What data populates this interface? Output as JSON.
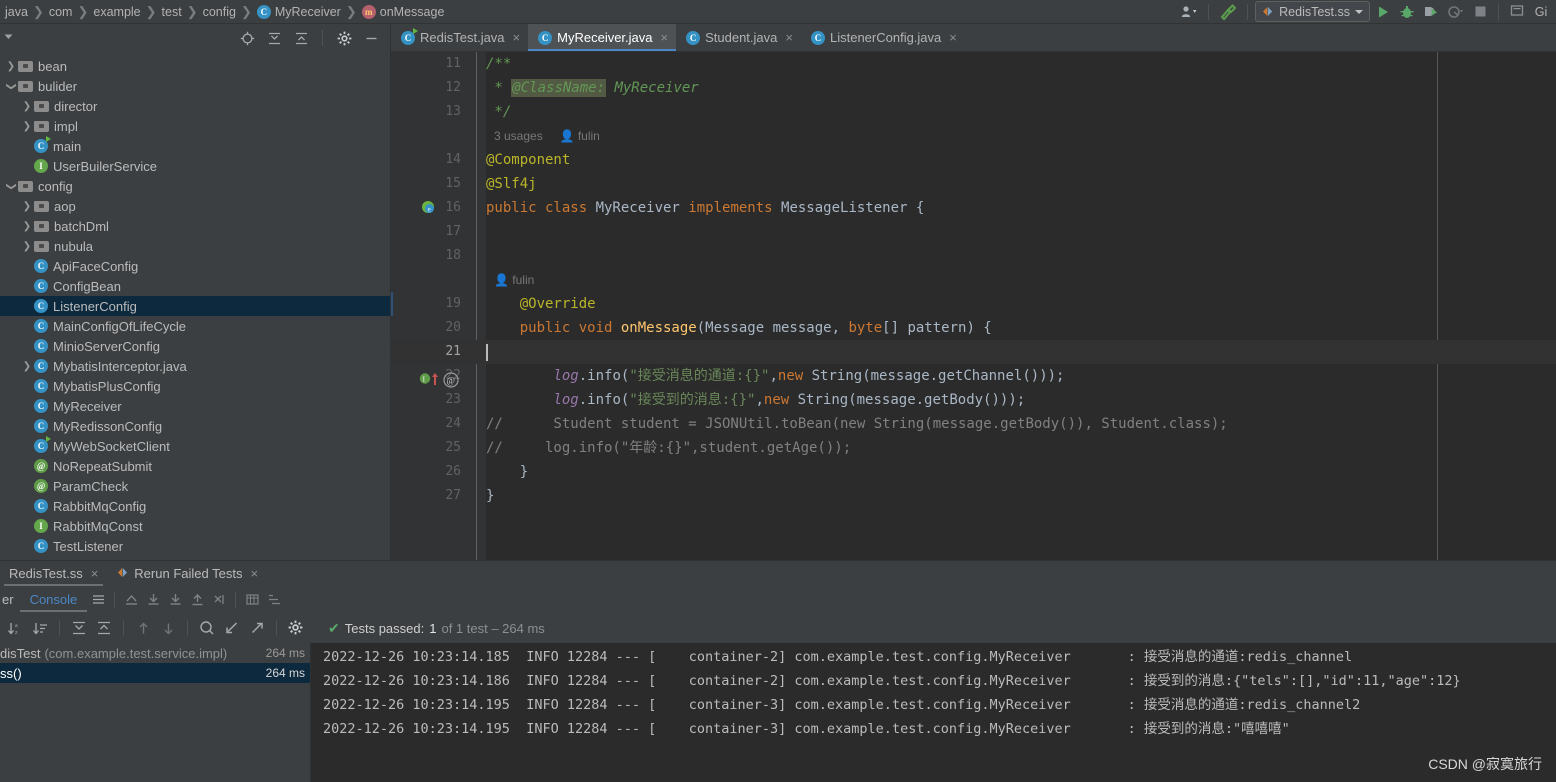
{
  "breadcrumb": {
    "items": [
      {
        "label": "java",
        "icon": null
      },
      {
        "label": "com",
        "icon": null
      },
      {
        "label": "example",
        "icon": null
      },
      {
        "label": "test",
        "icon": null
      },
      {
        "label": "config",
        "icon": null
      },
      {
        "label": "MyReceiver",
        "icon": "class-icon",
        "icon_letter": "C"
      },
      {
        "label": "onMessage",
        "icon": "method-icon",
        "icon_letter": "m"
      }
    ],
    "separator": "❯"
  },
  "toolbar": {
    "profiler_icon": "user-profiler-icon",
    "build_icon": "hammer-icon",
    "run_config": "RedisTest.ss",
    "run_icon": "run-icon",
    "debug_icon": "debug-icon",
    "run_coverage_icon": "run-with-coverage-icon",
    "profile_icon": "profile-icon",
    "stop_icon": "stop-icon",
    "search_icon": "search-everywhere-icon",
    "git_label": "Gi"
  },
  "project_panel": {
    "toolbar_icons": [
      "locate-icon",
      "expand-all-icon",
      "collapse-all-icon",
      "settings-icon",
      "hide-icon"
    ],
    "tree": [
      {
        "label": "bean",
        "kind": "folder",
        "indent": 0,
        "arrow": "collapsed"
      },
      {
        "label": "bulider",
        "kind": "folder",
        "indent": 0,
        "arrow": "expanded"
      },
      {
        "label": "director",
        "kind": "folder",
        "indent": 1,
        "arrow": "collapsed"
      },
      {
        "label": "impl",
        "kind": "folder",
        "indent": 1,
        "arrow": "collapsed"
      },
      {
        "label": "main",
        "kind": "class-runnable",
        "indent": 1,
        "arrow": "none"
      },
      {
        "label": "UserBuilerService",
        "kind": "interface",
        "indent": 1,
        "arrow": "none"
      },
      {
        "label": "config",
        "kind": "folder",
        "indent": 0,
        "arrow": "expanded"
      },
      {
        "label": "aop",
        "kind": "folder",
        "indent": 1,
        "arrow": "collapsed"
      },
      {
        "label": "batchDml",
        "kind": "folder",
        "indent": 1,
        "arrow": "collapsed"
      },
      {
        "label": "nubula",
        "kind": "folder",
        "indent": 1,
        "arrow": "collapsed"
      },
      {
        "label": "ApiFaceConfig",
        "kind": "class",
        "indent": 1,
        "arrow": "none"
      },
      {
        "label": "ConfigBean",
        "kind": "class",
        "indent": 1,
        "arrow": "none"
      },
      {
        "label": "ListenerConfig",
        "kind": "class",
        "indent": 1,
        "arrow": "none",
        "selected": true
      },
      {
        "label": "MainConfigOfLifeCycle",
        "kind": "class",
        "indent": 1,
        "arrow": "none"
      },
      {
        "label": "MinioServerConfig",
        "kind": "class",
        "indent": 1,
        "arrow": "none"
      },
      {
        "label": "MybatisInterceptor.java",
        "kind": "class",
        "indent": 1,
        "arrow": "collapsed"
      },
      {
        "label": "MybatisPlusConfig",
        "kind": "class",
        "indent": 1,
        "arrow": "none"
      },
      {
        "label": "MyReceiver",
        "kind": "class",
        "indent": 1,
        "arrow": "none"
      },
      {
        "label": "MyRedissonConfig",
        "kind": "class",
        "indent": 1,
        "arrow": "none"
      },
      {
        "label": "MyWebSocketClient",
        "kind": "class-runnable",
        "indent": 1,
        "arrow": "none"
      },
      {
        "label": "NoRepeatSubmit",
        "kind": "annotation",
        "indent": 1,
        "arrow": "none"
      },
      {
        "label": "ParamCheck",
        "kind": "annotation",
        "indent": 1,
        "arrow": "none"
      },
      {
        "label": "RabbitMqConfig",
        "kind": "class",
        "indent": 1,
        "arrow": "none"
      },
      {
        "label": "RabbitMqConst",
        "kind": "interface",
        "indent": 1,
        "arrow": "none"
      },
      {
        "label": "TestListener",
        "kind": "class",
        "indent": 1,
        "arrow": "none"
      }
    ]
  },
  "editor_tabs": [
    {
      "label": "RedisTest.java",
      "icon": "java-class-runnable-icon",
      "active": false
    },
    {
      "label": "MyReceiver.java",
      "icon": "java-class-icon",
      "active": true
    },
    {
      "label": "Student.java",
      "icon": "java-class-icon",
      "active": false
    },
    {
      "label": "ListenerConfig.java",
      "icon": "java-class-icon",
      "active": false
    }
  ],
  "editor": {
    "current_line": 21,
    "usages_hint": "3 usages",
    "author_hint": "fulin",
    "author_hint2": "fulin",
    "lines": [
      {
        "num": 11,
        "tokens": [
          {
            "t": "/**",
            "c": "cmt"
          }
        ]
      },
      {
        "num": 12,
        "tokens": [
          {
            "t": " * ",
            "c": "cmt"
          },
          {
            "t": "@ClassName:",
            "c": "hl-tag"
          },
          {
            "t": " MyReceiver",
            "c": "cmt"
          }
        ]
      },
      {
        "num": 13,
        "tokens": [
          {
            "t": " */",
            "c": "cmt"
          }
        ]
      },
      {
        "num": null,
        "hint": "3 usages",
        "hint_author": "fulin"
      },
      {
        "num": 14,
        "tokens": [
          {
            "t": "@Component",
            "c": "anno"
          }
        ]
      },
      {
        "num": 15,
        "tokens": [
          {
            "t": "@Slf4j",
            "c": "anno"
          }
        ]
      },
      {
        "num": 16,
        "tokens": [
          {
            "t": "public class ",
            "c": "kw"
          },
          {
            "t": "MyReceiver ",
            "c": "typ"
          },
          {
            "t": "implements ",
            "c": "kw"
          },
          {
            "t": "MessageListener {",
            "c": "typ"
          }
        ]
      },
      {
        "num": 17,
        "tokens": []
      },
      {
        "num": 18,
        "tokens": []
      },
      {
        "num": null,
        "hint_author": "fulin"
      },
      {
        "num": 19,
        "tokens": [
          {
            "t": "    @Override",
            "c": "anno"
          }
        ]
      },
      {
        "num": 20,
        "tokens": [
          {
            "t": "    public void ",
            "c": "kw"
          },
          {
            "t": "onMessage",
            "c": "mth"
          },
          {
            "t": "(Message message, ",
            "c": "typ"
          },
          {
            "t": "byte",
            "c": "kw"
          },
          {
            "t": "[] pattern) {",
            "c": "typ"
          }
        ]
      },
      {
        "num": 21,
        "tokens": []
      },
      {
        "num": 22,
        "tokens": [
          {
            "t": "        ",
            "c": "typ"
          },
          {
            "t": "log",
            "c": "fld"
          },
          {
            "t": ".info(",
            "c": "typ"
          },
          {
            "t": "\"接受消息的通道:{}\"",
            "c": "str"
          },
          {
            "t": ",",
            "c": "typ"
          },
          {
            "t": "new ",
            "c": "kw"
          },
          {
            "t": "String(message.getChannel()));",
            "c": "typ"
          }
        ]
      },
      {
        "num": 23,
        "tokens": [
          {
            "t": "        ",
            "c": "typ"
          },
          {
            "t": "log",
            "c": "fld"
          },
          {
            "t": ".info(",
            "c": "typ"
          },
          {
            "t": "\"接受到的消息:{}\"",
            "c": "str"
          },
          {
            "t": ",",
            "c": "typ"
          },
          {
            "t": "new ",
            "c": "kw"
          },
          {
            "t": "String(message.getBody()));",
            "c": "typ"
          }
        ]
      },
      {
        "num": 24,
        "tokens": [
          {
            "t": "//      Student student = JSONUtil.toBean(new String(message.getBody()), Student.class);",
            "c": "cmt2"
          }
        ]
      },
      {
        "num": 25,
        "tokens": [
          {
            "t": "//     log.info(\"年龄:{}\",student.getAge());",
            "c": "cmt2"
          }
        ]
      },
      {
        "num": 26,
        "tokens": [
          {
            "t": "    }",
            "c": "typ"
          }
        ]
      },
      {
        "num": 27,
        "tokens": [
          {
            "t": "}",
            "c": "typ"
          }
        ]
      }
    ]
  },
  "run_panel": {
    "tabs": [
      {
        "label": "RedisTest.ss",
        "icon": null,
        "active": true,
        "closable": true
      },
      {
        "label": "Rerun Failed Tests",
        "icon": "rerun-failed-icon",
        "active": false,
        "closable": true
      }
    ],
    "subtabs": [
      {
        "label": "er",
        "active": false
      },
      {
        "label": "Console",
        "active": true
      }
    ],
    "toolbar_row1_icons": [
      "menu-icon",
      "export-icon",
      "download-icon",
      "download-all-icon",
      "upload-icon",
      "wrap-icon",
      "table-icon",
      "tree-icon"
    ],
    "toolbar_row2_icons": [
      "sort-alpha-icon",
      "sort-duration-icon",
      "expand-all-icon",
      "collapse-all-icon",
      "prev-icon",
      "next-icon",
      "search-icon",
      "import-icon",
      "export-external-icon",
      "settings-icon"
    ],
    "status": {
      "check": "✔",
      "passed_label": "Tests passed:",
      "passed_count": "1",
      "of_text": "of 1 test – 264 ms"
    },
    "tests": [
      {
        "name": "disTest",
        "package": "(com.example.test.service.impl)",
        "time": "264 ms",
        "selected": false
      },
      {
        "name": "ss()",
        "package": "",
        "time": "264 ms",
        "selected": true
      }
    ],
    "console_lines": [
      "2022-12-26 10:23:14.185  INFO 12284 --- [    container-2] com.example.test.config.MyReceiver       : 接受消息的通道:redis_channel",
      "2022-12-26 10:23:14.186  INFO 12284 --- [    container-2] com.example.test.config.MyReceiver       : 接受到的消息:{\"tels\":[],\"id\":11,\"age\":12}",
      "2022-12-26 10:23:14.195  INFO 12284 --- [    container-3] com.example.test.config.MyReceiver       : 接受消息的通道:redis_channel2",
      "2022-12-26 10:23:14.195  INFO 12284 --- [    container-3] com.example.test.config.MyReceiver       : 接受到的消息:\"嘻嘻嘻\""
    ]
  },
  "watermark": "CSDN @寂寞旅行",
  "colors": {
    "background": "#3c3f41",
    "editor_bg": "#2b2b2b",
    "selection": "#0d293e",
    "accent": "#4a88c7",
    "keyword": "#cc7832",
    "string": "#6a8759",
    "comment": "#629755",
    "annotation": "#bbb529",
    "method": "#ffc66d",
    "field": "#9876aa",
    "green": "#62b543"
  }
}
